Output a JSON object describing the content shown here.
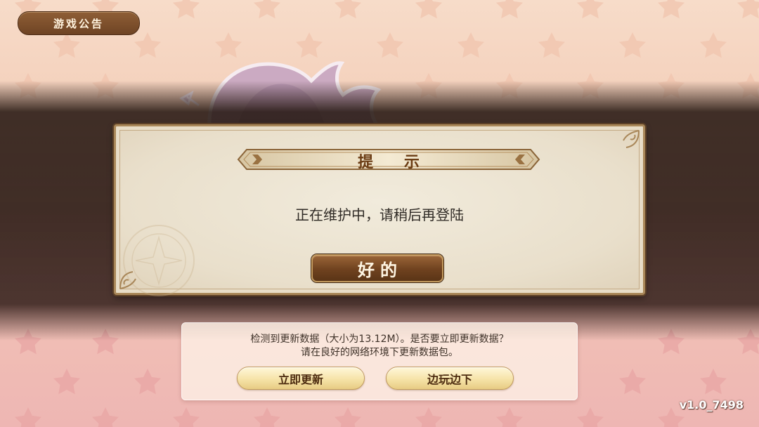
{
  "header": {
    "notice_label": "游戏公告"
  },
  "dialog": {
    "title": "提 示",
    "message": "正在维护中，请稍后再登陆",
    "ok_label": "好的"
  },
  "update_panel": {
    "line1": "检测到更新数据（大小为13.12M）。是否要立即更新数据？",
    "line2": "请在良好的网络环境下更新数据包。",
    "update_now_label": "立即更新",
    "play_while_download_label": "边玩边下"
  },
  "version": "v1.0_7498",
  "colors": {
    "background_top": "#f7dcc9",
    "background_bottom": "#eeb6b3",
    "dialog_panel": "#e7dcc7",
    "brown_button": "#6f4424",
    "gold_button": "#f6e3a8",
    "title_text": "#6b3c14"
  }
}
